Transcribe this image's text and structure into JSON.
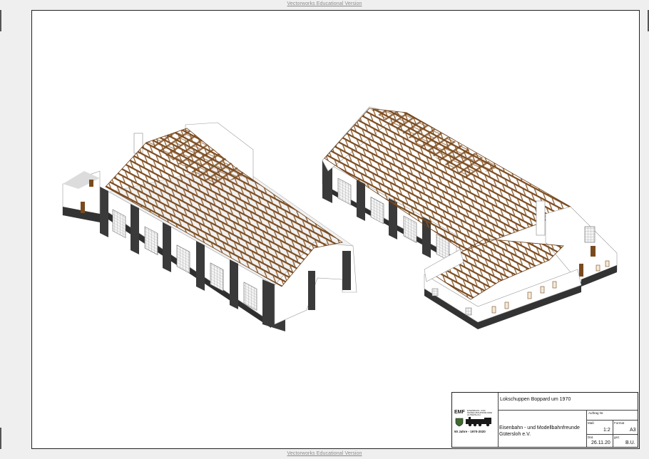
{
  "watermark_text": "Vectorworks Educational Version",
  "title_block": {
    "project_title": "Lokschuppen Boppard um 1970",
    "order_label": "Auftrag Nr.",
    "scale_label": "Maß",
    "scale_value": "1:2",
    "format_label": "Format",
    "format_value": "A3",
    "date_label": "Dat.",
    "date_value": "26.11.20",
    "drawn_label": "gez.",
    "drawn_value": "B.U.",
    "organization_line1": "Eisenbahn - und Modellbahnfreunde",
    "organization_line2": "Gütersloh e.V.",
    "logo_text": "EMF",
    "logo_small_line1": "EISENBAHN- UND",
    "logo_small_line2": "MODELLBAHNFREUNDE",
    "logo_small_line3": "GÜTERSLOH",
    "anniversary": "50 Jahre  -  1970-2020"
  },
  "colors": {
    "wood": "#7a4a1e",
    "wall": "#ffffff",
    "plinth": "#3a3a3a",
    "window": "#f3ead8"
  }
}
